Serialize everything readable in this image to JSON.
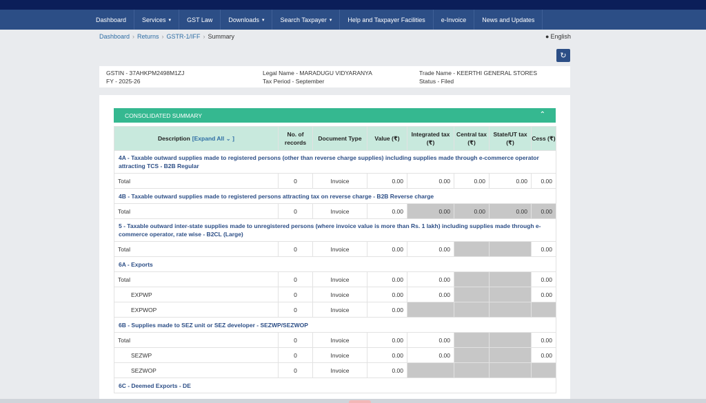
{
  "nav": {
    "items": [
      {
        "label": "Dashboard",
        "caret": false
      },
      {
        "label": "Services",
        "caret": true
      },
      {
        "label": "GST Law",
        "caret": false
      },
      {
        "label": "Downloads",
        "caret": true
      },
      {
        "label": "Search Taxpayer",
        "caret": true
      },
      {
        "label": "Help and Taxpayer Facilities",
        "caret": false
      },
      {
        "label": "e-Invoice",
        "caret": false
      },
      {
        "label": "News and Updates",
        "caret": false
      }
    ]
  },
  "breadcrumb": [
    "Dashboard",
    "Returns",
    "GSTR-1/IFF",
    "Summary"
  ],
  "language": "English",
  "taxpayer": {
    "gstin": "GSTIN - 37AHKPM2498M1ZJ",
    "fy": "FY - 2025-26",
    "legal_name": "Legal Name - MARADUGU VIDYARANYA",
    "tax_period": "Tax Period - September",
    "trade_name": "Trade Name - KEERTHI GENERAL STORES",
    "status": "Status - Filed"
  },
  "summary": {
    "title": "CONSOLIDATED SUMMARY",
    "headers": {
      "description": "Description",
      "expand_all": "[Expand All",
      "expand_close": "]",
      "records": "No. of records",
      "doc_type": "Document Type",
      "value": "Value (₹)",
      "igst": "Integrated tax (₹)",
      "cgst": "Central tax (₹)",
      "sgst": "State/UT tax (₹)",
      "cess": "Cess (₹)"
    }
  },
  "rows": [
    {
      "kind": "section",
      "text": "4A - Taxable outward supplies made to registered persons (other than reverse charge supplies) including supplies made through e-commerce operator attracting TCS - B2B Regular"
    },
    {
      "kind": "data",
      "label": "Total",
      "sub": false,
      "records": "0",
      "doc": "Invoice",
      "value": "0.00",
      "igst": "0.00",
      "cgst": "0.00",
      "sgst": "0.00",
      "cess": "0.00",
      "grey": []
    },
    {
      "kind": "section",
      "text": "4B - Taxable outward supplies made to registered persons attracting tax on reverse charge - B2B Reverse charge"
    },
    {
      "kind": "data",
      "label": "Total",
      "sub": false,
      "records": "0",
      "doc": "Invoice",
      "value": "0.00",
      "igst": "0.00",
      "cgst": "0.00",
      "sgst": "0.00",
      "cess": "0.00",
      "grey": [
        "igst",
        "cgst",
        "sgst",
        "cess"
      ]
    },
    {
      "kind": "section",
      "text": "5 - Taxable outward inter-state supplies made to unregistered persons (where invoice value is more than Rs. 1 lakh) including supplies made through e-commerce operator, rate wise - B2CL (Large)"
    },
    {
      "kind": "data",
      "label": "Total",
      "sub": false,
      "records": "0",
      "doc": "Invoice",
      "value": "0.00",
      "igst": "0.00",
      "cgst": "",
      "sgst": "",
      "cess": "0.00",
      "grey": [
        "cgst",
        "sgst"
      ]
    },
    {
      "kind": "section",
      "text": "6A - Exports"
    },
    {
      "kind": "data",
      "label": "Total",
      "sub": false,
      "records": "0",
      "doc": "Invoice",
      "value": "0.00",
      "igst": "0.00",
      "cgst": "",
      "sgst": "",
      "cess": "0.00",
      "grey": [
        "cgst",
        "sgst"
      ]
    },
    {
      "kind": "data",
      "label": "EXPWP",
      "sub": true,
      "records": "0",
      "doc": "Invoice",
      "value": "0.00",
      "igst": "0.00",
      "cgst": "",
      "sgst": "",
      "cess": "0.00",
      "grey": [
        "cgst",
        "sgst"
      ]
    },
    {
      "kind": "data",
      "label": "EXPWOP",
      "sub": true,
      "records": "0",
      "doc": "Invoice",
      "value": "0.00",
      "igst": "",
      "cgst": "",
      "sgst": "",
      "cess": "",
      "grey": [
        "igst",
        "cgst",
        "sgst",
        "cess"
      ]
    },
    {
      "kind": "section",
      "text": "6B - Supplies made to SEZ unit or SEZ developer - SEZWP/SEZWOP"
    },
    {
      "kind": "data",
      "label": "Total",
      "sub": false,
      "records": "0",
      "doc": "Invoice",
      "value": "0.00",
      "igst": "0.00",
      "cgst": "",
      "sgst": "",
      "cess": "0.00",
      "grey": [
        "cgst",
        "sgst"
      ]
    },
    {
      "kind": "data",
      "label": "SEZWP",
      "sub": true,
      "records": "0",
      "doc": "Invoice",
      "value": "0.00",
      "igst": "0.00",
      "cgst": "",
      "sgst": "",
      "cess": "0.00",
      "grey": [
        "cgst",
        "sgst"
      ]
    },
    {
      "kind": "data",
      "label": "SEZWOP",
      "sub": true,
      "records": "0",
      "doc": "Invoice",
      "value": "0.00",
      "igst": "",
      "cgst": "",
      "sgst": "",
      "cess": "",
      "grey": [
        "igst",
        "cgst",
        "sgst",
        "cess"
      ]
    },
    {
      "kind": "section",
      "text": "6C - Deemed Exports - DE"
    }
  ]
}
